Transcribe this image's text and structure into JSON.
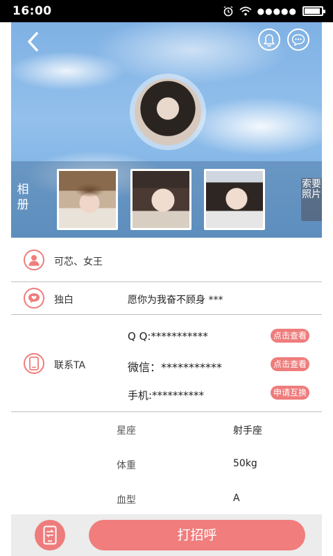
{
  "status_bar": {
    "time": "16:00",
    "signal_dots": "●●●●●",
    "battery_level": 0.9
  },
  "header": {
    "icons": {
      "back": "back-chevron-icon",
      "bell": "bell-icon",
      "message": "chat-bubble-icon"
    },
    "album_label": "相册",
    "request_photo_label": "索要照片"
  },
  "profile": {
    "nickname": "可芯、女王",
    "monologue_label": "独白",
    "monologue_text": "愿你为我奋不顾身  ***"
  },
  "contact": {
    "label": "联系TA",
    "qq": "Q  Q:***********",
    "wechat": "微信：***********",
    "phone": "手机:**********",
    "qq_action": "点击查看",
    "wechat_action": "点击查看",
    "phone_action": "申请互换"
  },
  "details": [
    {
      "label": "星座",
      "value": "射手座"
    },
    {
      "label": "体重",
      "value": "50kg"
    },
    {
      "label": "血型",
      "value": "A"
    }
  ],
  "bottom": {
    "greet_button": "打招呼"
  },
  "colors": {
    "accent": "#f07c7c",
    "sky": "#7fb1e4"
  }
}
